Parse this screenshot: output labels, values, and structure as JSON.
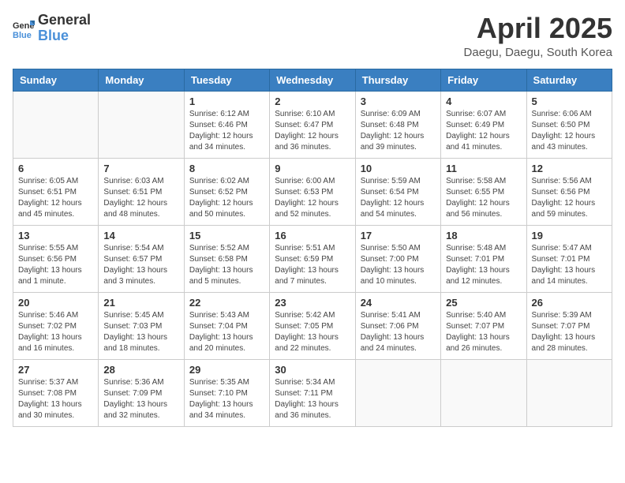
{
  "logo": {
    "text_general": "General",
    "text_blue": "Blue"
  },
  "header": {
    "month_year": "April 2025",
    "location": "Daegu, Daegu, South Korea"
  },
  "weekdays": [
    "Sunday",
    "Monday",
    "Tuesday",
    "Wednesday",
    "Thursday",
    "Friday",
    "Saturday"
  ],
  "weeks": [
    [
      {
        "day": "",
        "sunrise": "",
        "sunset": "",
        "daylight": ""
      },
      {
        "day": "",
        "sunrise": "",
        "sunset": "",
        "daylight": ""
      },
      {
        "day": "1",
        "sunrise": "Sunrise: 6:12 AM",
        "sunset": "Sunset: 6:46 PM",
        "daylight": "Daylight: 12 hours and 34 minutes."
      },
      {
        "day": "2",
        "sunrise": "Sunrise: 6:10 AM",
        "sunset": "Sunset: 6:47 PM",
        "daylight": "Daylight: 12 hours and 36 minutes."
      },
      {
        "day": "3",
        "sunrise": "Sunrise: 6:09 AM",
        "sunset": "Sunset: 6:48 PM",
        "daylight": "Daylight: 12 hours and 39 minutes."
      },
      {
        "day": "4",
        "sunrise": "Sunrise: 6:07 AM",
        "sunset": "Sunset: 6:49 PM",
        "daylight": "Daylight: 12 hours and 41 minutes."
      },
      {
        "day": "5",
        "sunrise": "Sunrise: 6:06 AM",
        "sunset": "Sunset: 6:50 PM",
        "daylight": "Daylight: 12 hours and 43 minutes."
      }
    ],
    [
      {
        "day": "6",
        "sunrise": "Sunrise: 6:05 AM",
        "sunset": "Sunset: 6:51 PM",
        "daylight": "Daylight: 12 hours and 45 minutes."
      },
      {
        "day": "7",
        "sunrise": "Sunrise: 6:03 AM",
        "sunset": "Sunset: 6:51 PM",
        "daylight": "Daylight: 12 hours and 48 minutes."
      },
      {
        "day": "8",
        "sunrise": "Sunrise: 6:02 AM",
        "sunset": "Sunset: 6:52 PM",
        "daylight": "Daylight: 12 hours and 50 minutes."
      },
      {
        "day": "9",
        "sunrise": "Sunrise: 6:00 AM",
        "sunset": "Sunset: 6:53 PM",
        "daylight": "Daylight: 12 hours and 52 minutes."
      },
      {
        "day": "10",
        "sunrise": "Sunrise: 5:59 AM",
        "sunset": "Sunset: 6:54 PM",
        "daylight": "Daylight: 12 hours and 54 minutes."
      },
      {
        "day": "11",
        "sunrise": "Sunrise: 5:58 AM",
        "sunset": "Sunset: 6:55 PM",
        "daylight": "Daylight: 12 hours and 56 minutes."
      },
      {
        "day": "12",
        "sunrise": "Sunrise: 5:56 AM",
        "sunset": "Sunset: 6:56 PM",
        "daylight": "Daylight: 12 hours and 59 minutes."
      }
    ],
    [
      {
        "day": "13",
        "sunrise": "Sunrise: 5:55 AM",
        "sunset": "Sunset: 6:56 PM",
        "daylight": "Daylight: 13 hours and 1 minute."
      },
      {
        "day": "14",
        "sunrise": "Sunrise: 5:54 AM",
        "sunset": "Sunset: 6:57 PM",
        "daylight": "Daylight: 13 hours and 3 minutes."
      },
      {
        "day": "15",
        "sunrise": "Sunrise: 5:52 AM",
        "sunset": "Sunset: 6:58 PM",
        "daylight": "Daylight: 13 hours and 5 minutes."
      },
      {
        "day": "16",
        "sunrise": "Sunrise: 5:51 AM",
        "sunset": "Sunset: 6:59 PM",
        "daylight": "Daylight: 13 hours and 7 minutes."
      },
      {
        "day": "17",
        "sunrise": "Sunrise: 5:50 AM",
        "sunset": "Sunset: 7:00 PM",
        "daylight": "Daylight: 13 hours and 10 minutes."
      },
      {
        "day": "18",
        "sunrise": "Sunrise: 5:48 AM",
        "sunset": "Sunset: 7:01 PM",
        "daylight": "Daylight: 13 hours and 12 minutes."
      },
      {
        "day": "19",
        "sunrise": "Sunrise: 5:47 AM",
        "sunset": "Sunset: 7:01 PM",
        "daylight": "Daylight: 13 hours and 14 minutes."
      }
    ],
    [
      {
        "day": "20",
        "sunrise": "Sunrise: 5:46 AM",
        "sunset": "Sunset: 7:02 PM",
        "daylight": "Daylight: 13 hours and 16 minutes."
      },
      {
        "day": "21",
        "sunrise": "Sunrise: 5:45 AM",
        "sunset": "Sunset: 7:03 PM",
        "daylight": "Daylight: 13 hours and 18 minutes."
      },
      {
        "day": "22",
        "sunrise": "Sunrise: 5:43 AM",
        "sunset": "Sunset: 7:04 PM",
        "daylight": "Daylight: 13 hours and 20 minutes."
      },
      {
        "day": "23",
        "sunrise": "Sunrise: 5:42 AM",
        "sunset": "Sunset: 7:05 PM",
        "daylight": "Daylight: 13 hours and 22 minutes."
      },
      {
        "day": "24",
        "sunrise": "Sunrise: 5:41 AM",
        "sunset": "Sunset: 7:06 PM",
        "daylight": "Daylight: 13 hours and 24 minutes."
      },
      {
        "day": "25",
        "sunrise": "Sunrise: 5:40 AM",
        "sunset": "Sunset: 7:07 PM",
        "daylight": "Daylight: 13 hours and 26 minutes."
      },
      {
        "day": "26",
        "sunrise": "Sunrise: 5:39 AM",
        "sunset": "Sunset: 7:07 PM",
        "daylight": "Daylight: 13 hours and 28 minutes."
      }
    ],
    [
      {
        "day": "27",
        "sunrise": "Sunrise: 5:37 AM",
        "sunset": "Sunset: 7:08 PM",
        "daylight": "Daylight: 13 hours and 30 minutes."
      },
      {
        "day": "28",
        "sunrise": "Sunrise: 5:36 AM",
        "sunset": "Sunset: 7:09 PM",
        "daylight": "Daylight: 13 hours and 32 minutes."
      },
      {
        "day": "29",
        "sunrise": "Sunrise: 5:35 AM",
        "sunset": "Sunset: 7:10 PM",
        "daylight": "Daylight: 13 hours and 34 minutes."
      },
      {
        "day": "30",
        "sunrise": "Sunrise: 5:34 AM",
        "sunset": "Sunset: 7:11 PM",
        "daylight": "Daylight: 13 hours and 36 minutes."
      },
      {
        "day": "",
        "sunrise": "",
        "sunset": "",
        "daylight": ""
      },
      {
        "day": "",
        "sunrise": "",
        "sunset": "",
        "daylight": ""
      },
      {
        "day": "",
        "sunrise": "",
        "sunset": "",
        "daylight": ""
      }
    ]
  ]
}
